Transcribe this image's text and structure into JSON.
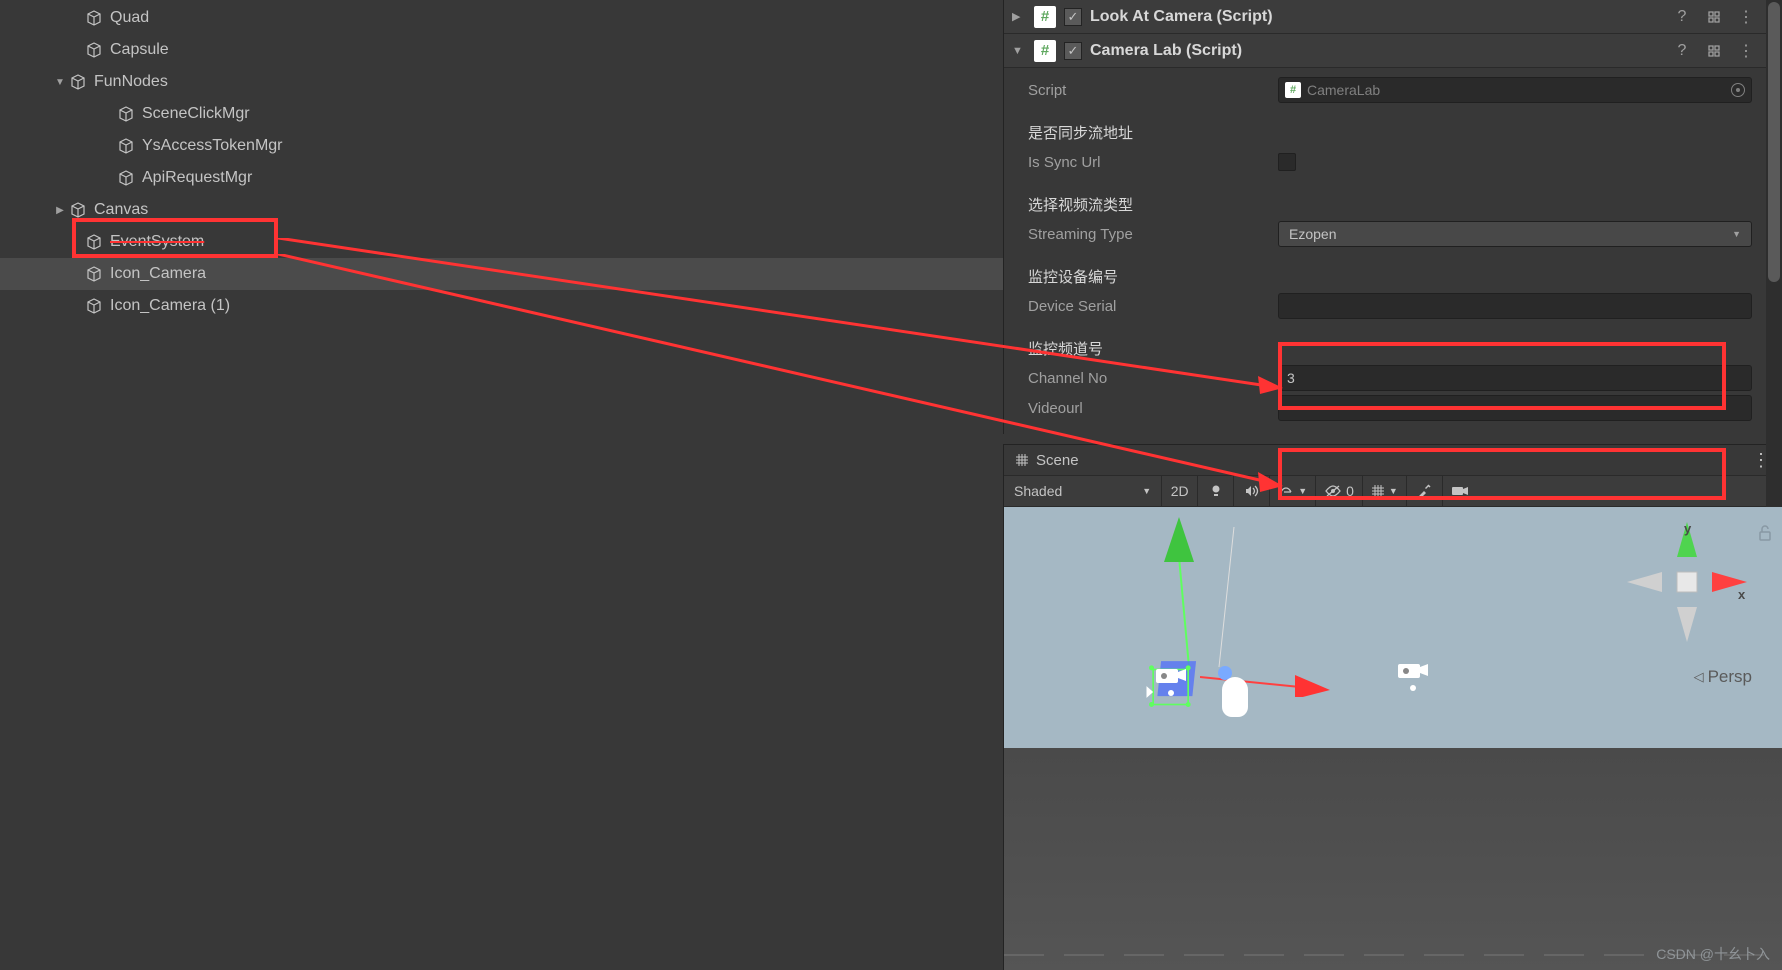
{
  "hierarchy": {
    "items": [
      {
        "label": "Quad",
        "indent": "indent-1",
        "expand": ""
      },
      {
        "label": "Capsule",
        "indent": "indent-1",
        "expand": ""
      },
      {
        "label": "FunNodes",
        "indent": "indent-0b",
        "expand": "▼"
      },
      {
        "label": "SceneClickMgr",
        "indent": "indent-2",
        "expand": ""
      },
      {
        "label": "YsAccessTokenMgr",
        "indent": "indent-2",
        "expand": ""
      },
      {
        "label": "ApiRequestMgr",
        "indent": "indent-2",
        "expand": ""
      },
      {
        "label": "Canvas",
        "indent": "indent-0b",
        "expand": "▶"
      },
      {
        "label": "EventSystem",
        "indent": "indent-1",
        "expand": "",
        "strike": true
      },
      {
        "label": "Icon_Camera",
        "indent": "indent-1",
        "expand": "",
        "selected": true
      },
      {
        "label": "Icon_Camera (1)",
        "indent": "indent-1",
        "expand": ""
      }
    ]
  },
  "inspector": {
    "components": {
      "lookAt": {
        "title": "Look At Camera (Script)"
      },
      "cameraLab": {
        "title": "Camera Lab (Script)",
        "script_label": "Script",
        "script_value": "CameraLab",
        "sync_header": "是否同步流地址",
        "sync_label": "Is Sync Url",
        "stream_header": "选择视频流类型",
        "stream_label": "Streaming Type",
        "stream_value": "Ezopen",
        "device_header": "监控设备编号",
        "device_label": "Device Serial",
        "device_value": "",
        "channel_header": "监控频道号",
        "channel_label": "Channel No",
        "channel_value": "3",
        "videourl_label": "Videourl",
        "videourl_value": ""
      }
    }
  },
  "scene": {
    "tab_label": "Scene",
    "shaded": "Shaded",
    "btn_2d": "2D",
    "gizmo_count": "0",
    "persp": "Persp",
    "axis_y": "y",
    "axis_x": "x"
  },
  "watermark": "CSDN @十幺卜入"
}
